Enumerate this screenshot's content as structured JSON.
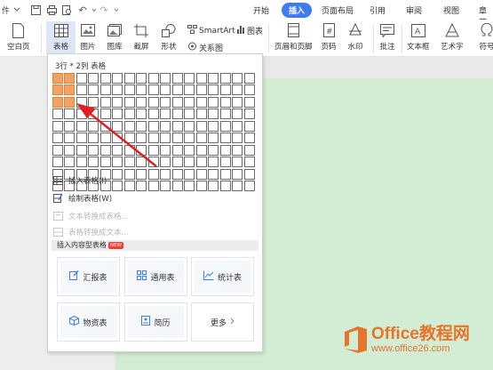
{
  "topbar": {
    "file_label": "件",
    "tabs": [
      "开始",
      "插入",
      "页面布局",
      "引用",
      "审阅",
      "视图",
      "章节"
    ],
    "active_tab": "插入"
  },
  "ribbon": {
    "blank_page": "空白页",
    "table": "表格",
    "picture": "图片",
    "gallery": "图库",
    "screenshot": "截屏",
    "shapes": "形状",
    "smartart": "SmartArt",
    "chart": "图表",
    "relation": "关系图",
    "header_footer": "页眉和页脚",
    "page_number": "页码",
    "watermark": "水印",
    "comment": "批注",
    "textbox": "文本框",
    "wordart": "艺术字",
    "symbol": "符号"
  },
  "table_panel": {
    "grid_label": "3行 * 2列 表格",
    "rows": 10,
    "cols": 17,
    "selected_rows": 3,
    "selected_cols": 2,
    "menu": [
      {
        "label": "插入表格(I)",
        "disabled": false
      },
      {
        "label": "绘制表格(W)",
        "disabled": false
      },
      {
        "label": "文本转换成表格...",
        "disabled": true
      },
      {
        "label": "表格转换成文本...",
        "disabled": true
      }
    ],
    "section_title": "插入内容型表格",
    "section_badge": "NEW",
    "cards": [
      {
        "label": "汇报表",
        "icon": "edit-icon"
      },
      {
        "label": "通用表",
        "icon": "grid-icon"
      },
      {
        "label": "统计表",
        "icon": "trend-icon"
      },
      {
        "label": "物资表",
        "icon": "box-icon"
      },
      {
        "label": "简历",
        "icon": "resume-icon"
      },
      {
        "label": "更多",
        "icon": "chevron-right-icon"
      }
    ]
  },
  "watermark": {
    "title": "Office教程网",
    "url": "www.office26.com"
  },
  "colors": {
    "accent": "#3d7cf2",
    "grid_highlight": "#f2a363",
    "page_green": "#d3ecd4",
    "arrow_red": "#e02020",
    "brand_orange": "#e7742b"
  }
}
